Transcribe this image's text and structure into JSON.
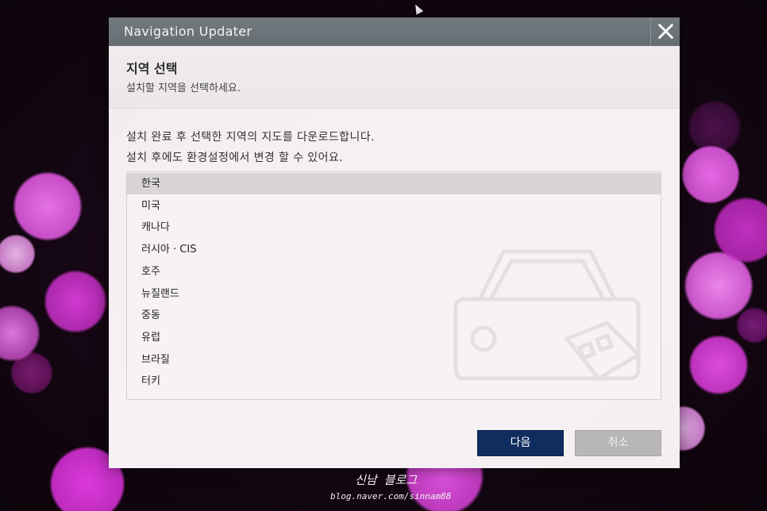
{
  "window": {
    "title": "Navigation Updater"
  },
  "header": {
    "title": "지역 선택",
    "subtitle": "설치할 지역을 선택하세요."
  },
  "description": {
    "line1": "설치 완료 후 선택한 지역의 지도를 다운로드합니다.",
    "line2": "설치 후에도 환경설정에서 변경 할 수 있어요."
  },
  "regions": {
    "selected_index": 0,
    "items": [
      "한국",
      "미국",
      "캐나다",
      "러시아 · CIS",
      "호주",
      "뉴질랜드",
      "중동",
      "유럽",
      "브라질",
      "터키"
    ]
  },
  "buttons": {
    "next": "다음",
    "cancel": "취소"
  },
  "watermark": {
    "name": "신남 블로그",
    "url": "blog.naver.com/sinnam88"
  },
  "icons": {
    "close": "close-icon",
    "cursor": "cursor-arrow-icon",
    "car": "car-icon"
  },
  "colors": {
    "titlebar": "#6d7479",
    "next_button": "#102d60",
    "cancel_button": "#b9b6b8",
    "selected_row": "#d9d5d7"
  }
}
